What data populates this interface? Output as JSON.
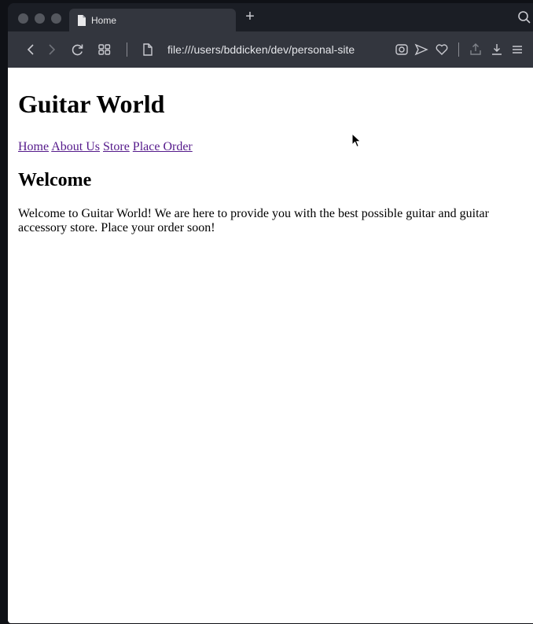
{
  "browser": {
    "tab": {
      "title": "Home",
      "icon": "document-icon"
    },
    "new_tab_label": "+",
    "toolbar": {
      "address": "file:///users/bddicken/dev/personal-site",
      "icons": [
        "back-icon",
        "forward-icon",
        "reload-icon",
        "speed-dial-icon",
        "page-info-icon",
        "camera-icon",
        "send-icon",
        "heart-icon",
        "share-icon",
        "download-icon",
        "menu-icon"
      ]
    },
    "colors": {
      "tabbar": "#1b1e25",
      "toolbar": "#33363e",
      "link_visited": "#551a8b"
    }
  },
  "page": {
    "heading": "Guitar World",
    "nav": [
      {
        "label": "Home"
      },
      {
        "label": "About Us"
      },
      {
        "label": "Store"
      },
      {
        "label": "Place Order"
      }
    ],
    "section_heading": "Welcome",
    "paragraph": "Welcome to Guitar World! We are here to provide you with the best possible guitar and guitar accessory store. Place your order soon!"
  }
}
